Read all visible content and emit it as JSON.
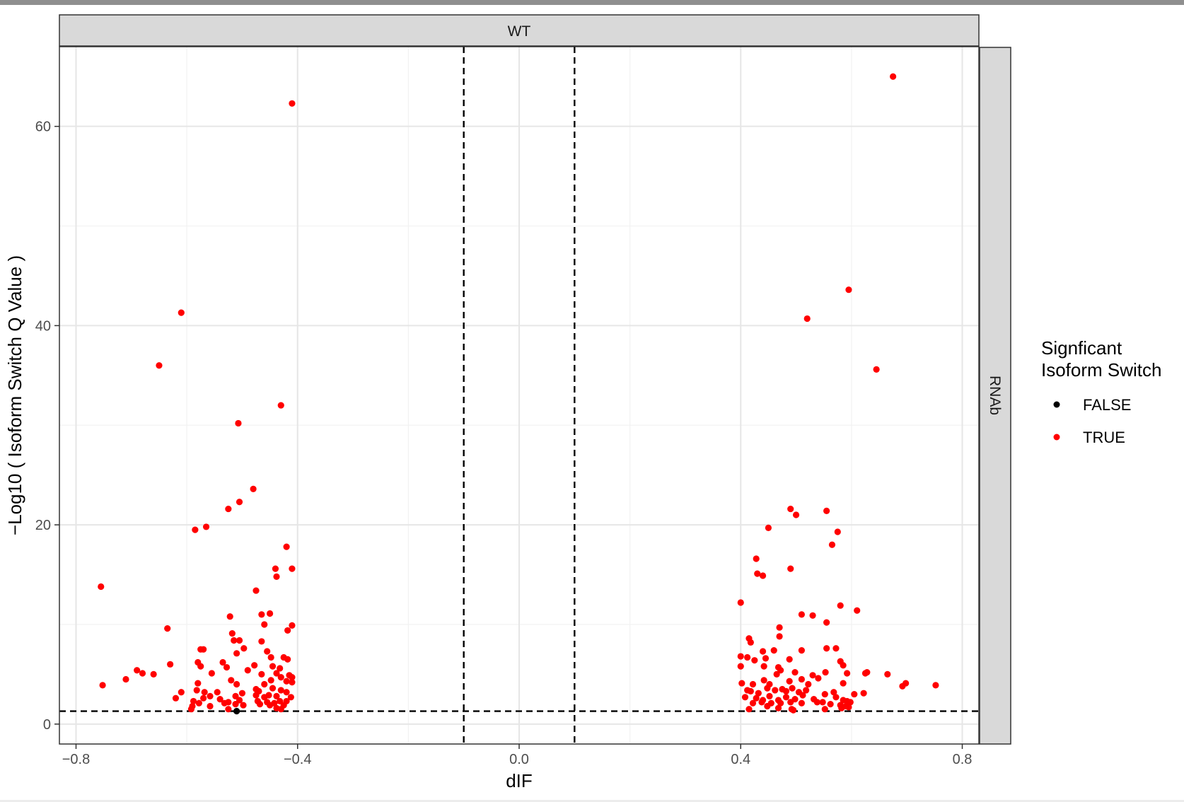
{
  "chart_data": {
    "type": "scatter",
    "facet": {
      "column_strip": "WT",
      "row_strip": "RNAb"
    },
    "xlabel": "dIF",
    "ylabel": "−Log10 ( Isoform Switch Q Value )",
    "xlim": [
      -0.83,
      0.83
    ],
    "ylim": [
      -2,
      68
    ],
    "x_ticks": [
      -0.8,
      -0.4,
      0.0,
      0.4,
      0.8
    ],
    "x_tick_labels": [
      "−0.8",
      "−0.4",
      "0.0",
      "0.4",
      "0.8"
    ],
    "y_ticks": [
      0,
      20,
      40,
      60
    ],
    "y_tick_labels": [
      "0",
      "20",
      "40",
      "60"
    ],
    "grid": true,
    "reference_lines": {
      "vertical": [
        -0.1,
        0.1
      ],
      "horizontal": [
        1.3
      ]
    },
    "legend": {
      "title": [
        "Signficant",
        "Isoform Switch"
      ],
      "position": "right",
      "entries": [
        {
          "label": "FALSE",
          "color": "#000000"
        },
        {
          "label": "TRUE",
          "color": "#ff0000"
        }
      ]
    },
    "series": [
      {
        "name": "FALSE",
        "color": "#000000",
        "points": [
          [
            -0.51,
            1.3
          ]
        ]
      },
      {
        "name": "TRUE",
        "color": "#ff0000",
        "points": [
          [
            -0.41,
            62.3
          ],
          [
            -0.61,
            41.3
          ],
          [
            -0.65,
            36.0
          ],
          [
            -0.43,
            32.0
          ],
          [
            -0.507,
            30.2
          ],
          [
            -0.48,
            23.6
          ],
          [
            -0.505,
            22.3
          ],
          [
            -0.525,
            21.6
          ],
          [
            -0.565,
            19.8
          ],
          [
            -0.585,
            19.5
          ],
          [
            -0.42,
            17.8
          ],
          [
            -0.44,
            15.6
          ],
          [
            -0.41,
            15.6
          ],
          [
            -0.438,
            14.8
          ],
          [
            -0.755,
            13.8
          ],
          [
            -0.475,
            13.4
          ],
          [
            -0.465,
            11.0
          ],
          [
            -0.45,
            11.1
          ],
          [
            -0.522,
            10.8
          ],
          [
            -0.46,
            10.0
          ],
          [
            -0.41,
            9.9
          ],
          [
            -0.418,
            9.4
          ],
          [
            -0.635,
            9.6
          ],
          [
            -0.518,
            9.1
          ],
          [
            -0.515,
            8.4
          ],
          [
            -0.505,
            8.4
          ],
          [
            -0.465,
            8.3
          ],
          [
            -0.575,
            7.5
          ],
          [
            -0.57,
            7.5
          ],
          [
            -0.497,
            7.6
          ],
          [
            -0.51,
            7.1
          ],
          [
            -0.455,
            7.3
          ],
          [
            -0.425,
            6.7
          ],
          [
            -0.448,
            6.7
          ],
          [
            -0.418,
            6.5
          ],
          [
            -0.58,
            6.2
          ],
          [
            -0.535,
            6.2
          ],
          [
            -0.63,
            6.0
          ],
          [
            -0.575,
            5.8
          ],
          [
            -0.528,
            5.7
          ],
          [
            -0.478,
            5.9
          ],
          [
            -0.445,
            5.8
          ],
          [
            -0.432,
            5.6
          ],
          [
            -0.69,
            5.4
          ],
          [
            -0.68,
            5.1
          ],
          [
            -0.66,
            5.0
          ],
          [
            -0.555,
            5.1
          ],
          [
            -0.49,
            5.4
          ],
          [
            -0.465,
            5.0
          ],
          [
            -0.438,
            5.1
          ],
          [
            -0.415,
            4.9
          ],
          [
            -0.41,
            4.7
          ],
          [
            -0.71,
            4.5
          ],
          [
            -0.52,
            4.4
          ],
          [
            -0.51,
            4.0
          ],
          [
            -0.448,
            4.4
          ],
          [
            -0.43,
            4.7
          ],
          [
            -0.41,
            4.2
          ],
          [
            -0.752,
            3.9
          ],
          [
            -0.58,
            4.1
          ],
          [
            -0.46,
            4.0
          ],
          [
            -0.42,
            4.3
          ],
          [
            -0.475,
            3.5
          ],
          [
            -0.47,
            3.3
          ],
          [
            -0.445,
            3.6
          ],
          [
            -0.43,
            3.4
          ],
          [
            -0.42,
            3.2
          ],
          [
            -0.61,
            3.2
          ],
          [
            -0.568,
            3.2
          ],
          [
            -0.582,
            3.4
          ],
          [
            -0.545,
            3.2
          ],
          [
            -0.5,
            3.1
          ],
          [
            -0.512,
            2.8
          ],
          [
            -0.475,
            2.9
          ],
          [
            -0.46,
            2.7
          ],
          [
            -0.452,
            2.9
          ],
          [
            -0.438,
            2.8
          ],
          [
            -0.412,
            2.7
          ],
          [
            -0.62,
            2.6
          ],
          [
            -0.57,
            2.6
          ],
          [
            -0.558,
            2.8
          ],
          [
            -0.54,
            2.5
          ],
          [
            -0.525,
            2.2
          ],
          [
            -0.505,
            2.4
          ],
          [
            -0.472,
            2.3
          ],
          [
            -0.455,
            2.2
          ],
          [
            -0.442,
            2.1
          ],
          [
            -0.432,
            2.3
          ],
          [
            -0.42,
            2.3
          ],
          [
            -0.588,
            2.3
          ],
          [
            -0.578,
            2.1
          ],
          [
            -0.532,
            2.1
          ],
          [
            -0.468,
            2.0
          ],
          [
            -0.45,
            1.9
          ],
          [
            -0.425,
            1.9
          ],
          [
            -0.59,
            1.8
          ],
          [
            -0.558,
            1.8
          ],
          [
            -0.512,
            2.0
          ],
          [
            -0.438,
            1.6
          ],
          [
            -0.43,
            1.5
          ],
          [
            -0.525,
            1.5
          ],
          [
            -0.592,
            1.5
          ],
          [
            -0.498,
            1.9
          ],
          [
            0.675,
            65.0
          ],
          [
            0.595,
            43.6
          ],
          [
            0.52,
            40.7
          ],
          [
            0.645,
            35.6
          ],
          [
            0.49,
            21.6
          ],
          [
            0.555,
            21.4
          ],
          [
            0.5,
            21.0
          ],
          [
            0.45,
            19.7
          ],
          [
            0.575,
            19.3
          ],
          [
            0.565,
            18.0
          ],
          [
            0.428,
            16.6
          ],
          [
            0.49,
            15.6
          ],
          [
            0.43,
            15.1
          ],
          [
            0.44,
            14.9
          ],
          [
            0.4,
            12.2
          ],
          [
            0.58,
            11.9
          ],
          [
            0.61,
            11.4
          ],
          [
            0.51,
            11.0
          ],
          [
            0.53,
            10.9
          ],
          [
            0.555,
            10.2
          ],
          [
            0.47,
            9.7
          ],
          [
            0.415,
            8.6
          ],
          [
            0.418,
            8.2
          ],
          [
            0.47,
            8.8
          ],
          [
            0.51,
            7.4
          ],
          [
            0.44,
            7.3
          ],
          [
            0.46,
            7.4
          ],
          [
            0.555,
            7.6
          ],
          [
            0.572,
            7.6
          ],
          [
            0.4,
            6.8
          ],
          [
            0.412,
            6.7
          ],
          [
            0.425,
            6.4
          ],
          [
            0.445,
            6.6
          ],
          [
            0.488,
            6.5
          ],
          [
            0.58,
            6.3
          ],
          [
            0.585,
            5.9
          ],
          [
            0.4,
            5.8
          ],
          [
            0.442,
            5.8
          ],
          [
            0.468,
            5.7
          ],
          [
            0.472,
            5.4
          ],
          [
            0.498,
            5.2
          ],
          [
            0.53,
            4.9
          ],
          [
            0.553,
            5.2
          ],
          [
            0.592,
            5.1
          ],
          [
            0.625,
            5.1
          ],
          [
            0.628,
            5.2
          ],
          [
            0.665,
            5.0
          ],
          [
            0.465,
            5.0
          ],
          [
            0.51,
            4.5
          ],
          [
            0.54,
            4.6
          ],
          [
            0.442,
            4.4
          ],
          [
            0.422,
            4.0
          ],
          [
            0.402,
            4.1
          ],
          [
            0.452,
            4.0
          ],
          [
            0.488,
            4.3
          ],
          [
            0.522,
            4.0
          ],
          [
            0.585,
            4.1
          ],
          [
            0.692,
            3.8
          ],
          [
            0.698,
            4.1
          ],
          [
            0.752,
            3.9
          ],
          [
            0.412,
            3.4
          ],
          [
            0.418,
            3.3
          ],
          [
            0.432,
            3.1
          ],
          [
            0.448,
            3.6
          ],
          [
            0.462,
            3.4
          ],
          [
            0.475,
            3.5
          ],
          [
            0.482,
            3.3
          ],
          [
            0.493,
            3.6
          ],
          [
            0.505,
            3.2
          ],
          [
            0.518,
            3.4
          ],
          [
            0.552,
            3.0
          ],
          [
            0.568,
            3.2
          ],
          [
            0.605,
            3.0
          ],
          [
            0.622,
            3.1
          ],
          [
            0.408,
            2.7
          ],
          [
            0.428,
            2.6
          ],
          [
            0.44,
            2.4
          ],
          [
            0.452,
            2.8
          ],
          [
            0.468,
            2.4
          ],
          [
            0.482,
            2.7
          ],
          [
            0.498,
            2.5
          ],
          [
            0.512,
            2.9
          ],
          [
            0.532,
            2.5
          ],
          [
            0.548,
            2.2
          ],
          [
            0.572,
            2.7
          ],
          [
            0.585,
            2.4
          ],
          [
            0.592,
            2.3
          ],
          [
            0.598,
            2.2
          ],
          [
            0.422,
            2.1
          ],
          [
            0.438,
            2.2
          ],
          [
            0.455,
            2.1
          ],
          [
            0.472,
            2.1
          ],
          [
            0.49,
            2.2
          ],
          [
            0.51,
            2.1
          ],
          [
            0.538,
            2.2
          ],
          [
            0.562,
            2.0
          ],
          [
            0.58,
            1.9
          ],
          [
            0.59,
            1.8
          ],
          [
            0.415,
            1.5
          ],
          [
            0.448,
            1.8
          ],
          [
            0.468,
            1.6
          ],
          [
            0.492,
            1.5
          ],
          [
            0.495,
            1.4
          ],
          [
            0.552,
            1.5
          ],
          [
            0.582,
            1.6
          ],
          [
            0.595,
            1.7
          ]
        ]
      }
    ]
  }
}
